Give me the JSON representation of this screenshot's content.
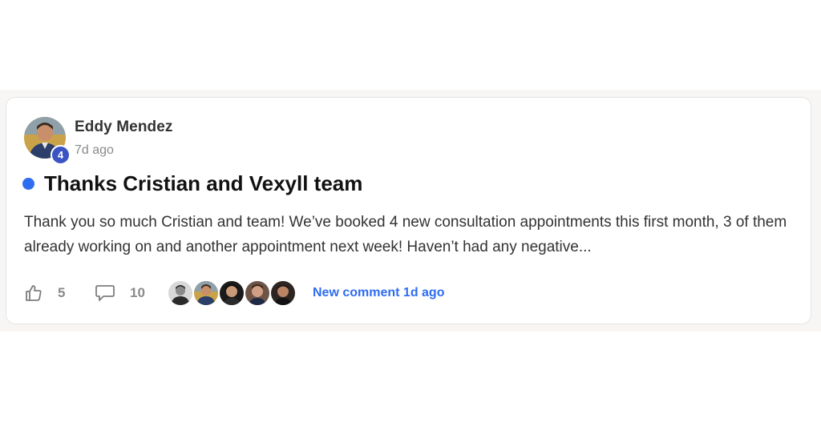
{
  "post": {
    "author": {
      "name": "Eddy Mendez",
      "level": "4"
    },
    "time": "7d ago",
    "title": "Thanks Cristian and Vexyll team",
    "body": "Thank you so much Cristian and team! We’ve booked 4 new consultation appointments this first month, 3 of them already working on and another appointment next week! Haven’t had any negative...",
    "likes": "5",
    "comments": "10",
    "latest_activity": "New comment 1d ago"
  },
  "colors": {
    "accent": "#2f6df0",
    "level_badge": "#3b54c4",
    "card_border": "#e4e4e4"
  },
  "icons": {
    "like": "thumbs-up-icon",
    "comment": "speech-bubble-icon"
  }
}
